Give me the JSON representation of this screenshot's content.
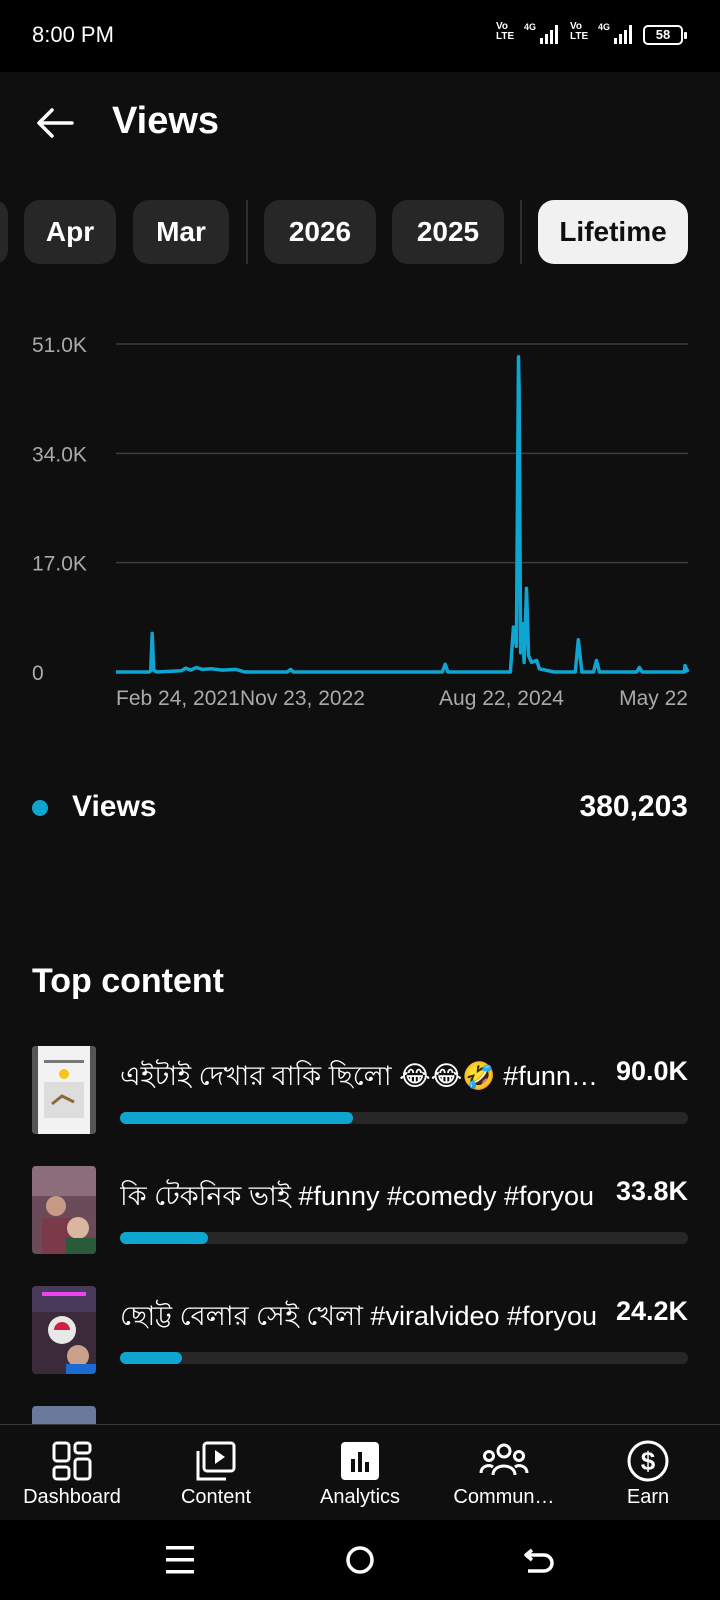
{
  "status_bar": {
    "time": "8:00 PM",
    "sim1": {
      "volte": "Vo LTE",
      "network": "4G"
    },
    "sim2": {
      "volte": "Vo LTE",
      "network": "4G"
    },
    "battery": "58"
  },
  "header": {
    "back_icon": "arrow-left-icon",
    "title": "Views"
  },
  "filter_chips": [
    {
      "label": "Apr",
      "active": false
    },
    {
      "label": "Mar",
      "active": false
    },
    {
      "label": "2026",
      "active": false
    },
    {
      "label": "2025",
      "active": false
    },
    {
      "label": "Lifetime",
      "active": true
    }
  ],
  "chart_data": {
    "type": "line",
    "title": "",
    "xlabel": "",
    "ylabel": "",
    "ylim": [
      0,
      51000
    ],
    "y_ticks": [
      "51.0K",
      "34.0K",
      "17.0K",
      "0"
    ],
    "x_ticks": [
      "Feb 24, 2021",
      "Nov 23, 2022",
      "Aug 22, 2024",
      "May 22"
    ],
    "x_range": [
      "2021-02-24",
      "2026-05-22"
    ],
    "grid": true,
    "series": [
      {
        "name": "Views",
        "color": "#0ea5d0",
        "points": [
          [
            "2021-02-24",
            0
          ],
          [
            "2021-06-15",
            0
          ],
          [
            "2021-06-20",
            200
          ],
          [
            "2021-06-25",
            6000
          ],
          [
            "2021-06-30",
            300
          ],
          [
            "2021-07-10",
            0
          ],
          [
            "2021-10-01",
            200
          ],
          [
            "2021-10-15",
            600
          ],
          [
            "2021-11-01",
            300
          ],
          [
            "2021-11-20",
            700
          ],
          [
            "2021-12-10",
            400
          ],
          [
            "2022-01-10",
            500
          ],
          [
            "2022-02-15",
            300
          ],
          [
            "2022-04-01",
            400
          ],
          [
            "2022-05-01",
            0
          ],
          [
            "2022-09-20",
            0
          ],
          [
            "2022-10-01",
            400
          ],
          [
            "2022-10-10",
            0
          ],
          [
            "2024-02-20",
            0
          ],
          [
            "2024-03-01",
            1200
          ],
          [
            "2024-03-10",
            0
          ],
          [
            "2024-10-05",
            0
          ],
          [
            "2024-10-15",
            7000
          ],
          [
            "2024-10-25",
            4000
          ],
          [
            "2024-11-01",
            49000
          ],
          [
            "2024-11-03",
            44000
          ],
          [
            "2024-11-08",
            3000
          ],
          [
            "2024-11-15",
            7500
          ],
          [
            "2024-11-20",
            1500
          ],
          [
            "2024-11-28",
            13000
          ],
          [
            "2024-12-05",
            2500
          ],
          [
            "2024-12-15",
            1500
          ],
          [
            "2025-01-01",
            1800
          ],
          [
            "2025-01-10",
            500
          ],
          [
            "2025-03-01",
            0
          ],
          [
            "2025-05-10",
            0
          ],
          [
            "2025-05-20",
            5000
          ],
          [
            "2025-06-01",
            0
          ],
          [
            "2025-07-10",
            0
          ],
          [
            "2025-07-20",
            1800
          ],
          [
            "2025-07-30",
            0
          ],
          [
            "2025-12-01",
            0
          ],
          [
            "2025-12-10",
            700
          ],
          [
            "2025-12-20",
            0
          ],
          [
            "2026-05-10",
            0
          ],
          [
            "2026-05-12",
            1000
          ],
          [
            "2026-05-22",
            0
          ]
        ]
      }
    ]
  },
  "legend": {
    "label": "Views",
    "total": "380,203"
  },
  "top_content": {
    "title": "Top content",
    "items": [
      {
        "title": "এইটাই দেখার  বাকি ছিলো 😂😂🤣 #funny #comedy",
        "views": "90.0K",
        "fraction": 0.41
      },
      {
        "title": "কি টেকনিক ভাই #funny #comedy #foryou",
        "views": "33.8K",
        "fraction": 0.155
      },
      {
        "title": "ছোট্ট বেলার সেই খেলা #viralvideo #foryou",
        "views": "24.2K",
        "fraction": 0.11
      }
    ]
  },
  "bottom_nav": [
    {
      "label": "Dashboard",
      "icon": "dashboard-grid-icon"
    },
    {
      "label": "Content",
      "icon": "content-play-icon"
    },
    {
      "label": "Analytics",
      "icon": "analytics-bars-icon",
      "active": true
    },
    {
      "label": "Commun…",
      "icon": "community-people-icon"
    },
    {
      "label": "Earn",
      "icon": "earn-dollar-icon"
    }
  ],
  "system_nav": {
    "menu_icon": "menu-lines-icon",
    "home_icon": "home-circle-icon",
    "back_icon": "back-arrow-icon"
  }
}
